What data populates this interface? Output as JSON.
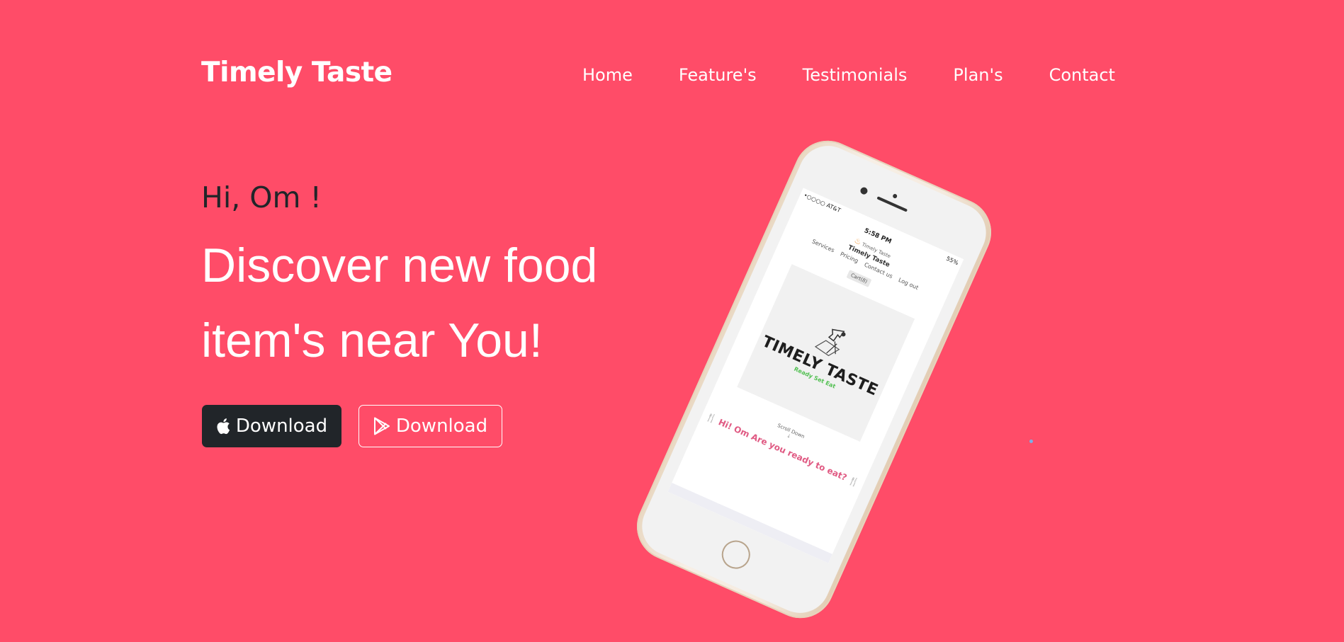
{
  "brand": "Timely Taste",
  "nav": [
    "Home",
    "Feature's",
    "Testimonials",
    "Plan's",
    "Contact"
  ],
  "hero": {
    "greeting": "Hi, Om !",
    "headline": "Discover new food item's near You!",
    "apple_button": "Download",
    "play_button": "Download"
  },
  "phone_screen": {
    "carrier": "•○○○○ AT&T",
    "time": "5:58 PM",
    "battery": "55%",
    "logo_text": "Timely Taste",
    "site_title": "Timely Taste",
    "menu": [
      "Services",
      "Pricing",
      "Contact us",
      "Log out"
    ],
    "cart": "Cart(8)",
    "banner_title": "TIMELY TASTE",
    "banner_tagline": "Ready Set Eat",
    "scroll_text": "Scroll Down",
    "scroll_arrow": "↓",
    "promo": "Hi! Om Are you ready to eat?"
  },
  "colors": {
    "background": "#ff4c68",
    "dark_button": "#212529",
    "text_white": "#ffffff",
    "promo": "#e05a83"
  }
}
